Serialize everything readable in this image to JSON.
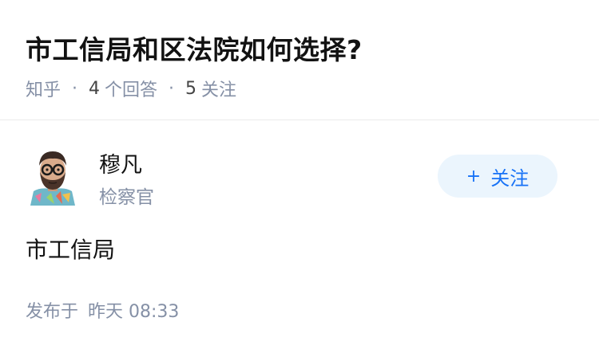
{
  "question": {
    "title": "市工信局和区法院如何选择?",
    "source": "知乎",
    "answer_count": "4",
    "answer_label": "个回答",
    "follow_count": "5",
    "follow_label": "关注"
  },
  "author": {
    "name": "穆凡",
    "title": "检察官",
    "avatar_icon": "bearded-man-with-glasses-avatar",
    "follow_button_label": "关注",
    "follow_button_icon": "plus-icon"
  },
  "answer": {
    "content": "市工信局",
    "publish_prefix": "发布于",
    "publish_time": "昨天 08:33"
  },
  "colors": {
    "primary_text": "#121212",
    "secondary_text": "#8590a6",
    "accent_blue": "#1772f6",
    "follow_bg": "#ebf5fd"
  }
}
